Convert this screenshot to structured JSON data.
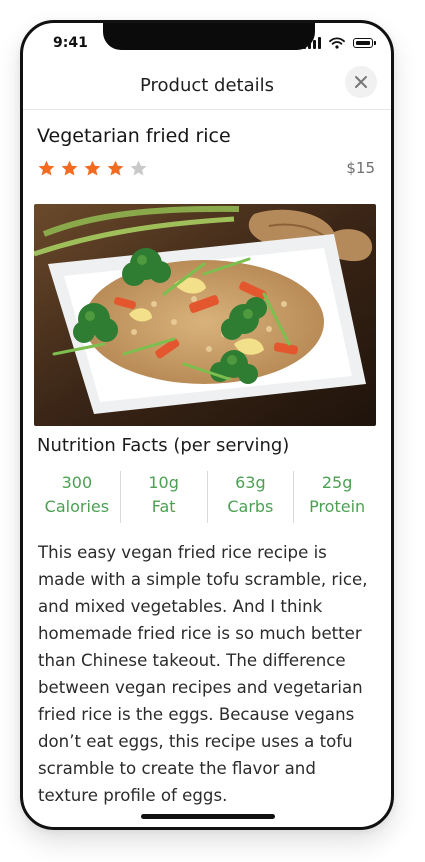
{
  "status_bar": {
    "time": "9:41"
  },
  "header": {
    "title": "Product details"
  },
  "product": {
    "name": "Vegetarian fried rice",
    "rating": 4,
    "rating_max": 5,
    "price": "$15",
    "star_color": "#f26b21"
  },
  "nutrition": {
    "title": "Nutrition Facts (per serving)",
    "items": [
      {
        "value": "300",
        "label": "Calories"
      },
      {
        "value": "10g",
        "label": "Fat"
      },
      {
        "value": "63g",
        "label": "Carbs"
      },
      {
        "value": "25g",
        "label": "Protein"
      }
    ],
    "accent": "#4ca052"
  },
  "description": "This easy vegan fried rice recipe is made with a simple tofu scramble, rice, and mixed vegetables. And I think homemade fried rice is so much better than Chinese takeout. The difference between vegan recipes and vegetarian fried rice is the eggs. Because vegans don’t eat eggs, this recipe uses a tofu scramble to create the flavor and texture profile of eggs.",
  "icons": {
    "close": "close-icon",
    "signal": "signal-icon",
    "wifi": "wifi-icon",
    "battery": "battery-icon",
    "star": "star-icon"
  }
}
